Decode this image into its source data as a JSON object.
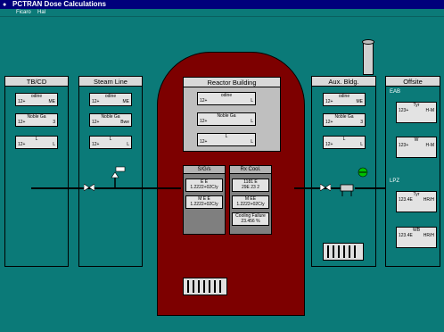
{
  "window": {
    "title": "PCTRAN Dose Calculations"
  },
  "menu": [
    "Ficaro",
    "Hal"
  ],
  "panels": {
    "tbcd": {
      "title": "TB/CD",
      "cards": [
        {
          "label": "odine",
          "value": "12+ ",
          "unit": "ME"
        },
        {
          "label": "Noble Ga",
          "value": "12+ ",
          "unit": "3"
        },
        {
          "label": "L",
          "value": "12+ ",
          "unit": "L"
        }
      ]
    },
    "steam": {
      "title": "Steam Line",
      "cards": [
        {
          "label": "odine",
          "value": "12+ ",
          "unit": "ME"
        },
        {
          "label": "Noble Ga",
          "value": "12+ ",
          "unit": "Bwe"
        },
        {
          "label": "L",
          "value": "12+ ",
          "unit": "L"
        }
      ]
    },
    "aux": {
      "title": "Aux. Bldg.",
      "cards": [
        {
          "label": "odine",
          "value": "12+ ",
          "unit": "ME"
        },
        {
          "label": "Noble Ga",
          "value": "12+ ",
          "unit": "3"
        },
        {
          "label": "L",
          "value": "12+ ",
          "unit": "L"
        }
      ]
    },
    "offsite": {
      "title": "Offsite",
      "eab_label": "EAB",
      "lpz_label": "LPZ",
      "eab_cards": [
        {
          "label": "Tyr",
          "value": "123+ ",
          "unit": "H-M"
        },
        {
          "label": "W",
          "value": "123+ ",
          "unit": "H-M"
        }
      ],
      "lpz_cards": [
        {
          "label": "Tyr",
          "value": "123.4E ",
          "unit": "HR/H"
        },
        {
          "label": "WB",
          "value": "123.4E ",
          "unit": "HR/H"
        }
      ]
    }
  },
  "reactor": {
    "title": "Reactor Building",
    "cards": [
      {
        "label": "odine",
        "value": "12+ ",
        "unit": "L"
      },
      {
        "label": "Noble Ga",
        "value": "12+ ",
        "unit": "L"
      },
      {
        "label": "L",
        "value": "12+ ",
        "unit": "L"
      }
    ],
    "sg": {
      "title": "S/G/s",
      "cards": [
        {
          "label": "E E",
          "value": "1.2222+02C/y"
        },
        {
          "label": "M E E",
          "value": "1.2222+02C/y"
        }
      ]
    },
    "rx": {
      "title": "Rx Cool.",
      "cards": [
        {
          "label": "1181 E",
          "value": "29E 23 2"
        },
        {
          "label": "M EE",
          "value": "1.2222+02C/y"
        },
        {
          "label": "Cooling Failure",
          "value": "23.456 %"
        }
      ]
    }
  },
  "colors": {
    "background": "#0b7a78",
    "reactor": "#7d0000",
    "titlebar": "#00007b"
  }
}
